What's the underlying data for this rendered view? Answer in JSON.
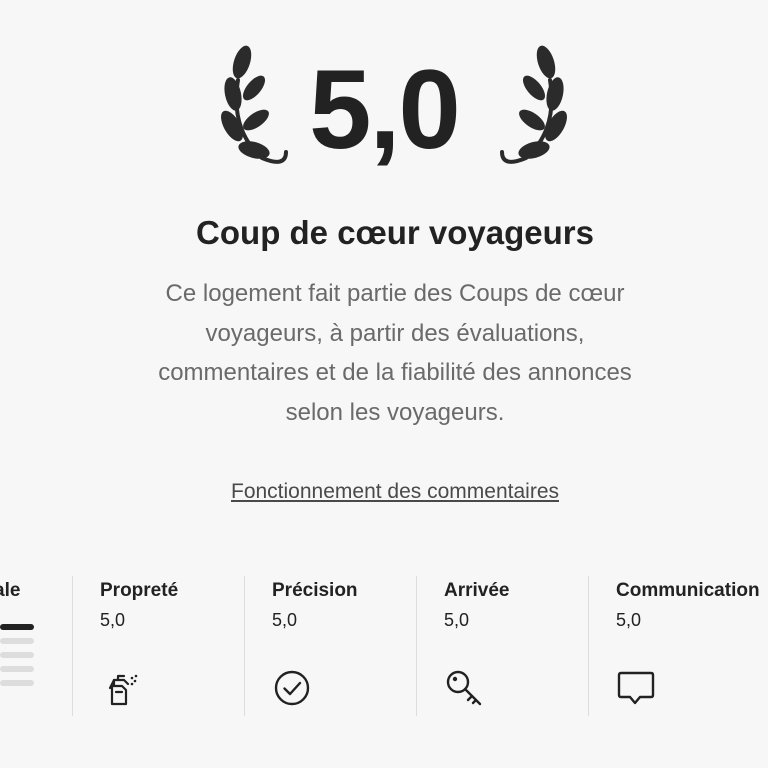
{
  "hero": {
    "score": "5,0",
    "title": "Coup de cœur voyageurs",
    "description": "Ce logement fait partie des Coups de cœur voyageurs, à partir des évaluations, commentaires et de la fiabilité des annonces selon les voyageurs.",
    "how_link": "Fonctionnement des commentaires"
  },
  "overall": {
    "label": "ale",
    "distribution": [
      1.0,
      0.0,
      0.0,
      0.0,
      0.0
    ]
  },
  "categories": [
    {
      "label": "Propreté",
      "value": "5,0",
      "icon": "spray-bottle-icon"
    },
    {
      "label": "Précision",
      "value": "5,0",
      "icon": "check-circle-icon"
    },
    {
      "label": "Arrivée",
      "value": "5,0",
      "icon": "key-icon"
    },
    {
      "label": "Communication",
      "value": "5,0",
      "icon": "chat-bubble-icon"
    }
  ],
  "colors": {
    "text": "#222222",
    "muted": "#6a6a6a",
    "bar_fill": "#222222",
    "bar_track": "#dddddd",
    "background": "#f7f7f7"
  }
}
